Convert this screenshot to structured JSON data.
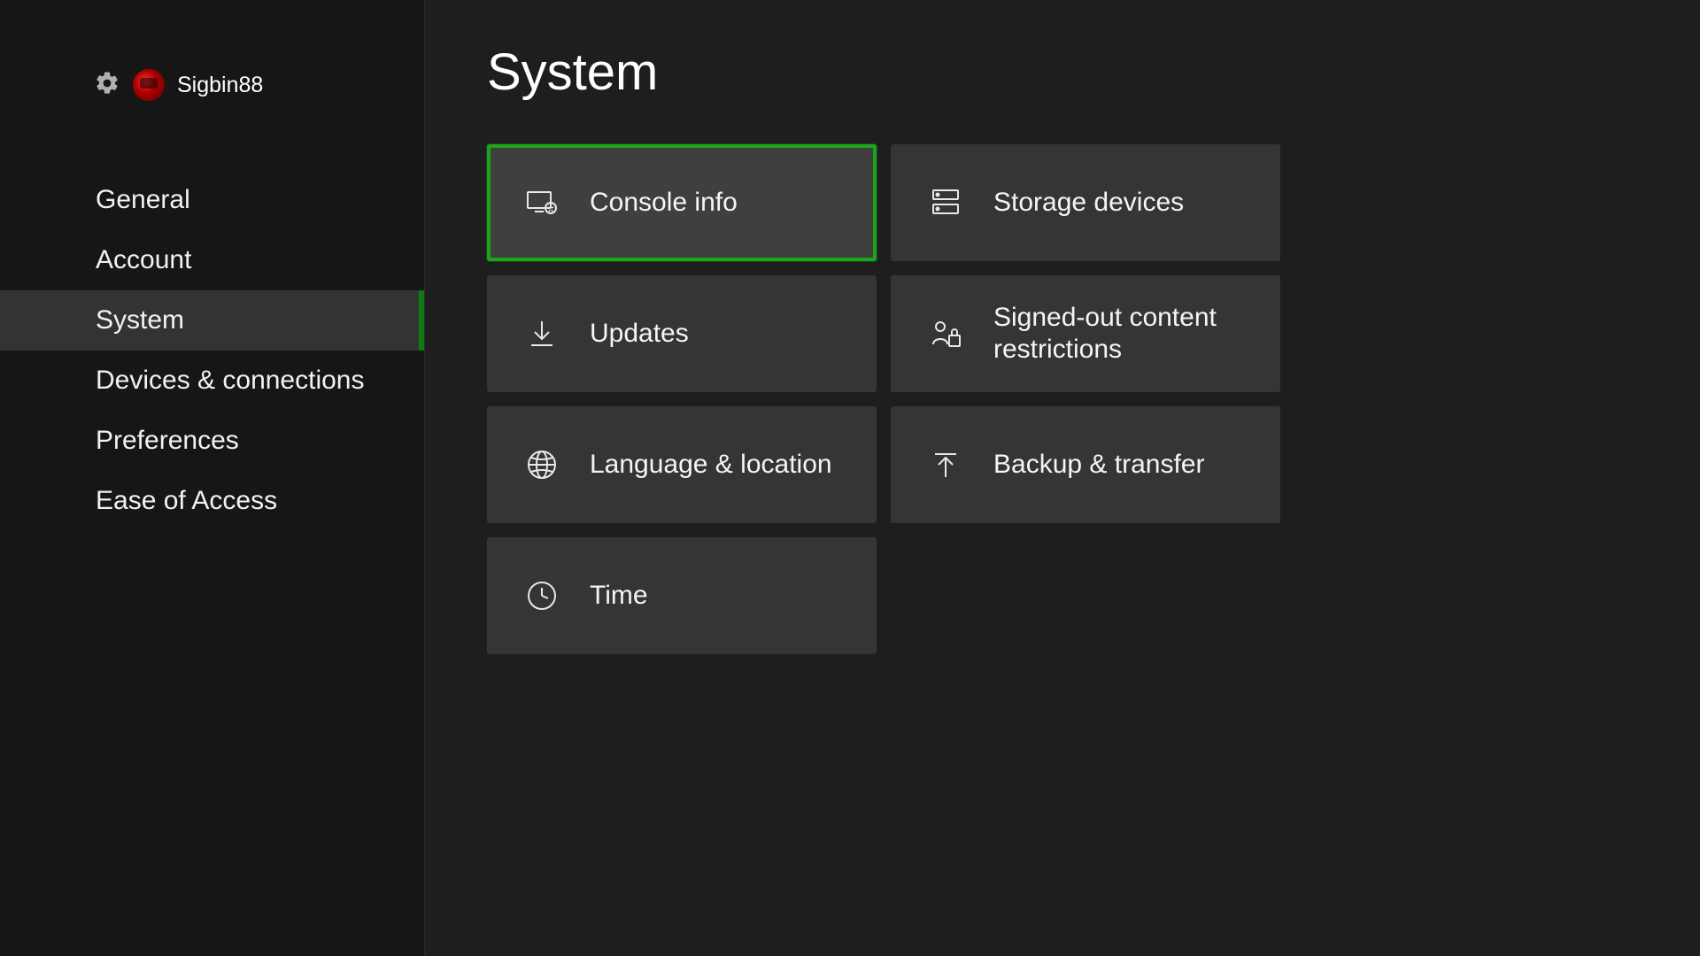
{
  "user": {
    "name": "Sigbin88"
  },
  "sidebar": {
    "items": [
      {
        "label": "General"
      },
      {
        "label": "Account"
      },
      {
        "label": "System"
      },
      {
        "label": "Devices & connections"
      },
      {
        "label": "Preferences"
      },
      {
        "label": "Ease of Access"
      }
    ],
    "active_index": 2
  },
  "page": {
    "title": "System"
  },
  "tiles": {
    "console_info": "Console info",
    "storage_devices": "Storage devices",
    "updates": "Updates",
    "content_restrictions": "Signed-out content restrictions",
    "language_location": "Language & location",
    "backup_transfer": "Backup & transfer",
    "time": "Time"
  },
  "colors": {
    "accent": "#1ba51b",
    "bg": "#1e1e1e",
    "sidebar_bg": "#161616",
    "tile_bg": "#353535"
  }
}
